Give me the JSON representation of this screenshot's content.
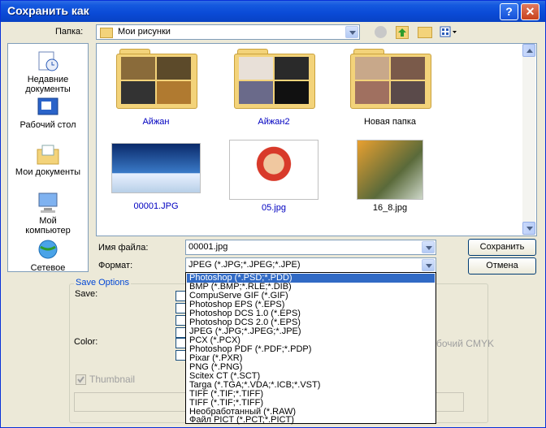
{
  "window": {
    "title": "Сохранить как",
    "help_label": "?",
    "close_label": "✕"
  },
  "folder_bar": {
    "label": "Папка:",
    "value": "Мои рисунки"
  },
  "places": [
    {
      "label": "Недавние документы",
      "icon": "recent-documents-icon"
    },
    {
      "label": "Рабочий стол",
      "icon": "desktop-icon"
    },
    {
      "label": "Мои документы",
      "icon": "my-documents-icon"
    },
    {
      "label": "Мой компьютер",
      "icon": "my-computer-icon"
    },
    {
      "label": "Сетевое",
      "icon": "network-icon"
    }
  ],
  "files": [
    {
      "name": "Айжан",
      "kind": "folder"
    },
    {
      "name": "Айжан2",
      "kind": "folder"
    },
    {
      "name": "Новая папка",
      "kind": "folder"
    },
    {
      "name": "00001.JPG",
      "kind": "image"
    },
    {
      "name": "05.jpg",
      "kind": "image"
    },
    {
      "name": "16_8.jpg",
      "kind": "image"
    }
  ],
  "filename": {
    "label": "Имя файла:",
    "value": "00001.jpg"
  },
  "format": {
    "label": "Формат:",
    "value": "JPEG (*.JPG;*.JPEG;*.JPE)"
  },
  "buttons": {
    "save": "Сохранить",
    "cancel": "Отмена"
  },
  "save_options": {
    "title": "Save Options",
    "save_label": "Save:",
    "color_label": "Color:",
    "thumbnail_label": "Thumbnail",
    "cmyk_partial": "бочий CMYK"
  },
  "format_list": [
    "Photoshop (*.PSD;*.PDD)",
    "BMP (*.BMP;*.RLE;*.DIB)",
    "CompuServe GIF (*.GIF)",
    "Photoshop EPS (*.EPS)",
    "Photoshop DCS 1.0 (*.EPS)",
    "Photoshop DCS 2.0 (*.EPS)",
    "JPEG (*.JPG;*.JPEG;*.JPE)",
    "PCX (*.PCX)",
    "Photoshop PDF (*.PDF;*.PDP)",
    "Pixar (*.PXR)",
    "PNG (*.PNG)",
    "Scitex CT (*.SCT)",
    "Targa (*.TGA;*.VDA;*.ICB;*.VST)",
    "TIFF (*.TIF;*.TIFF)",
    "TIFF (*.TIF;*.TIFF)",
    "Необработанный (*.RAW)",
    "Файл PICT (*.PCT;*.PICT)"
  ],
  "selected_format_index": 0
}
